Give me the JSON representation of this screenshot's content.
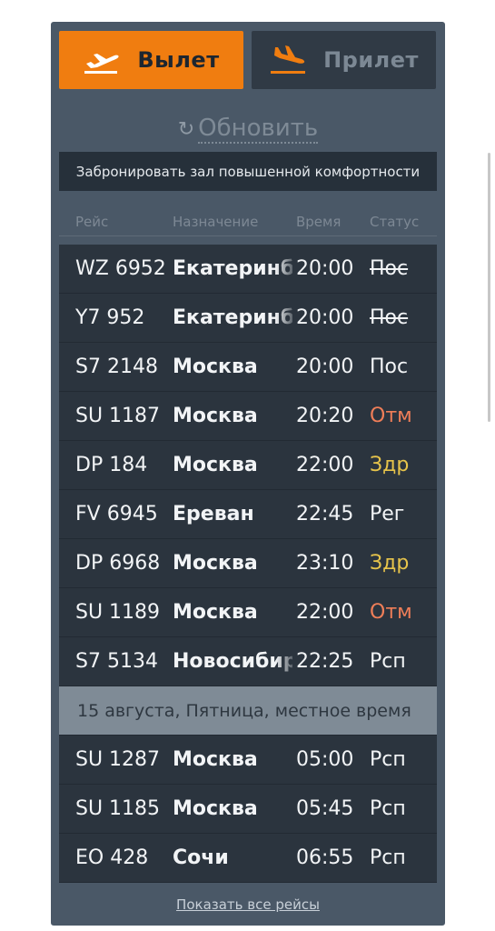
{
  "tabs": {
    "departure_label": "Вылет",
    "arrival_label": "Прилет",
    "active_color": "#f07d10"
  },
  "refresh": {
    "label": "Обновить",
    "icon": "refresh-icon"
  },
  "lounge_link": "Забронировать зал повышенной комфортности",
  "columns": {
    "flight": "Рейс",
    "destination": "Назначение",
    "time": "Время",
    "status": "Статус"
  },
  "flights": [
    {
      "flight": "WZ 6952",
      "destination": "Екатеринбург",
      "time": "20:00",
      "status": "Пос",
      "status_type": "landed"
    },
    {
      "flight": "Y7 952",
      "destination": "Екатеринбург",
      "time": "20:00",
      "status": "Пос",
      "status_type": "landed"
    },
    {
      "flight": "S7 2148",
      "destination": "Москва",
      "time": "20:00",
      "status": "Пос",
      "status_type": "normal"
    },
    {
      "flight": "SU 1187",
      "destination": "Москва",
      "time": "20:20",
      "status": "Отм",
      "status_type": "cancelled"
    },
    {
      "flight": "DP 184",
      "destination": "Москва",
      "time": "22:00",
      "status": "Здр",
      "status_type": "delayed"
    },
    {
      "flight": "FV 6945",
      "destination": "Ереван",
      "time": "22:45",
      "status": "Рег",
      "status_type": "normal"
    },
    {
      "flight": "DP 6968",
      "destination": "Москва",
      "time": "23:10",
      "status": "Здр",
      "status_type": "delayed"
    },
    {
      "flight": "SU 1189",
      "destination": "Москва",
      "time": "22:00",
      "status": "Отм",
      "status_type": "cancelled"
    },
    {
      "flight": "S7 5134",
      "destination": "Новосибирск",
      "time": "22:25",
      "status": "Рсп",
      "status_type": "normal"
    }
  ],
  "date_separator": "15 августа, Пятница, местное время",
  "flights_next_day": [
    {
      "flight": "SU 1287",
      "destination": "Москва",
      "time": "05:00",
      "status": "Рсп",
      "status_type": "normal"
    },
    {
      "flight": "SU 1185",
      "destination": "Москва",
      "time": "05:45",
      "status": "Рсп",
      "status_type": "normal"
    },
    {
      "flight": "EO 428",
      "destination": "Сочи",
      "time": "06:55",
      "status": "Рсп",
      "status_type": "normal"
    }
  ],
  "show_all_link": "Показать все рейсы",
  "status_colors": {
    "cancelled": "#ef7e58",
    "delayed": "#e7c44b",
    "normal": "#f2f4f6"
  }
}
